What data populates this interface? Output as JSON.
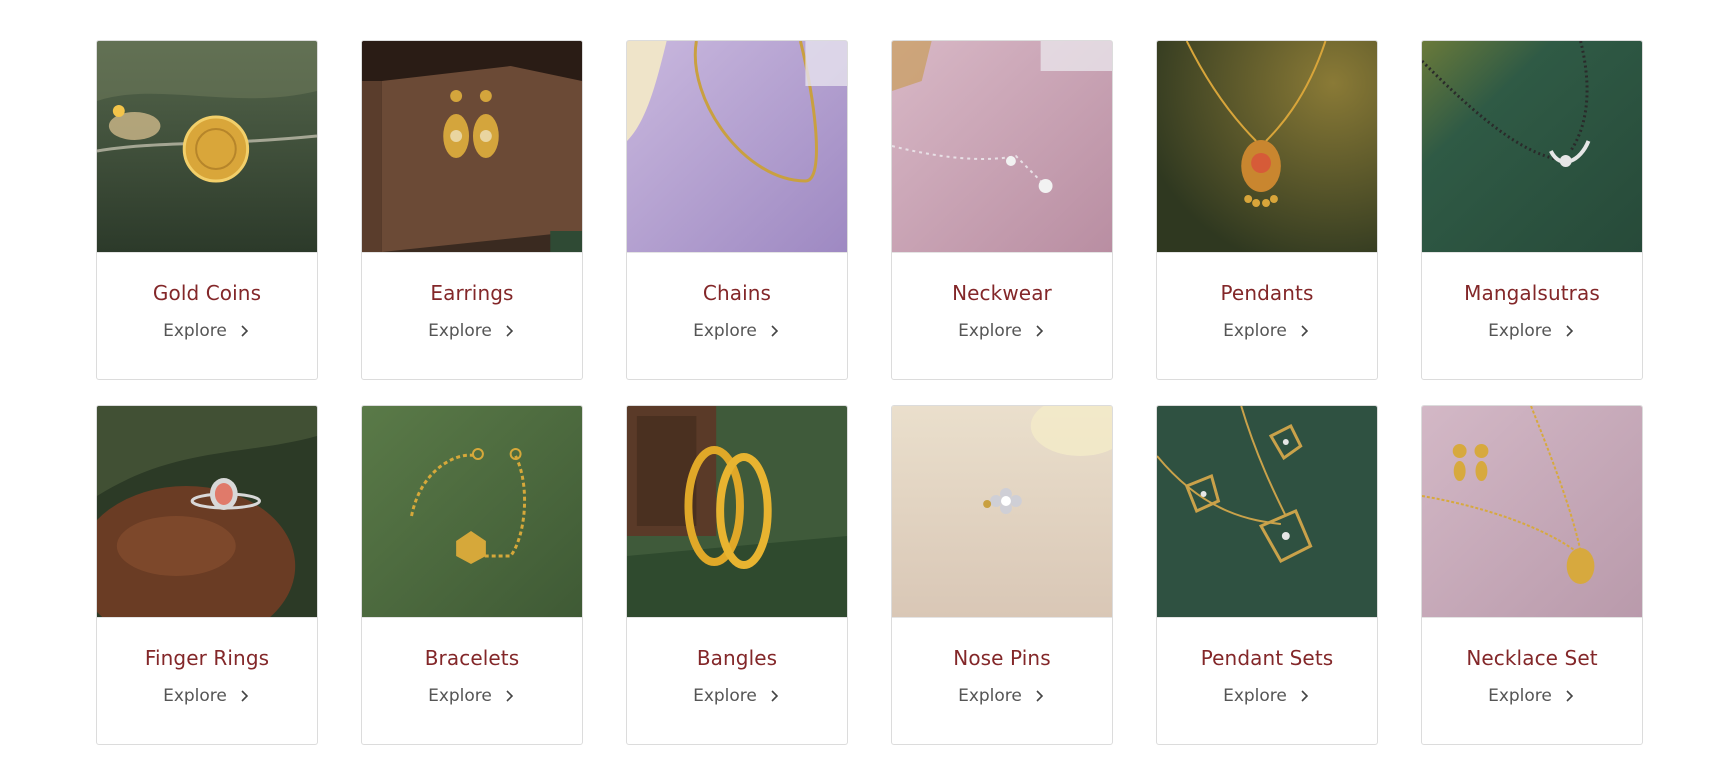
{
  "categories": [
    {
      "title": "Gold Coins",
      "explore": "Explore",
      "image_icon": "gold-coin-icon",
      "bg": "#3c4f3a",
      "accent": "#d9a63a"
    },
    {
      "title": "Earrings",
      "explore": "Explore",
      "image_icon": "earrings-icon",
      "bg": "#4a3326",
      "accent": "#d4a53c"
    },
    {
      "title": "Chains",
      "explore": "Explore",
      "image_icon": "chain-icon",
      "bg": "#b5a3cf",
      "accent": "#c9a040"
    },
    {
      "title": "Neckwear",
      "explore": "Explore",
      "image_icon": "necklace-icon",
      "bg": "#c8a3b4",
      "accent": "#e8e0e6"
    },
    {
      "title": "Pendants",
      "explore": "Explore",
      "image_icon": "pendant-icon",
      "bg": "#4b4a2a",
      "accent": "#c9862f"
    },
    {
      "title": "Mangalsutras",
      "explore": "Explore",
      "image_icon": "mangalsutra-icon",
      "bg": "#2f5a45",
      "accent": "#d8d8d8"
    },
    {
      "title": "Finger Rings",
      "explore": "Explore",
      "image_icon": "ring-icon",
      "bg": "#3a2a20",
      "accent": "#e07a6a"
    },
    {
      "title": "Bracelets",
      "explore": "Explore",
      "image_icon": "bracelet-icon",
      "bg": "#4a6a3e",
      "accent": "#d6a83a"
    },
    {
      "title": "Bangles",
      "explore": "Explore",
      "image_icon": "bangles-icon",
      "bg": "#3f5a3a",
      "accent": "#e0a828"
    },
    {
      "title": "Nose Pins",
      "explore": "Explore",
      "image_icon": "nose-pin-icon",
      "bg": "#e3d6c8",
      "accent": "#cfcfd6"
    },
    {
      "title": "Pendant Sets",
      "explore": "Explore",
      "image_icon": "pendant-set-icon",
      "bg": "#2f5141",
      "accent": "#caa24a"
    },
    {
      "title": "Necklace Set",
      "explore": "Explore",
      "image_icon": "necklace-set-icon",
      "bg": "#c6a7b8",
      "accent": "#d7a93e"
    }
  ],
  "colors": {
    "title": "#832729",
    "explore": "#555555",
    "border": "#dcdcdc"
  }
}
